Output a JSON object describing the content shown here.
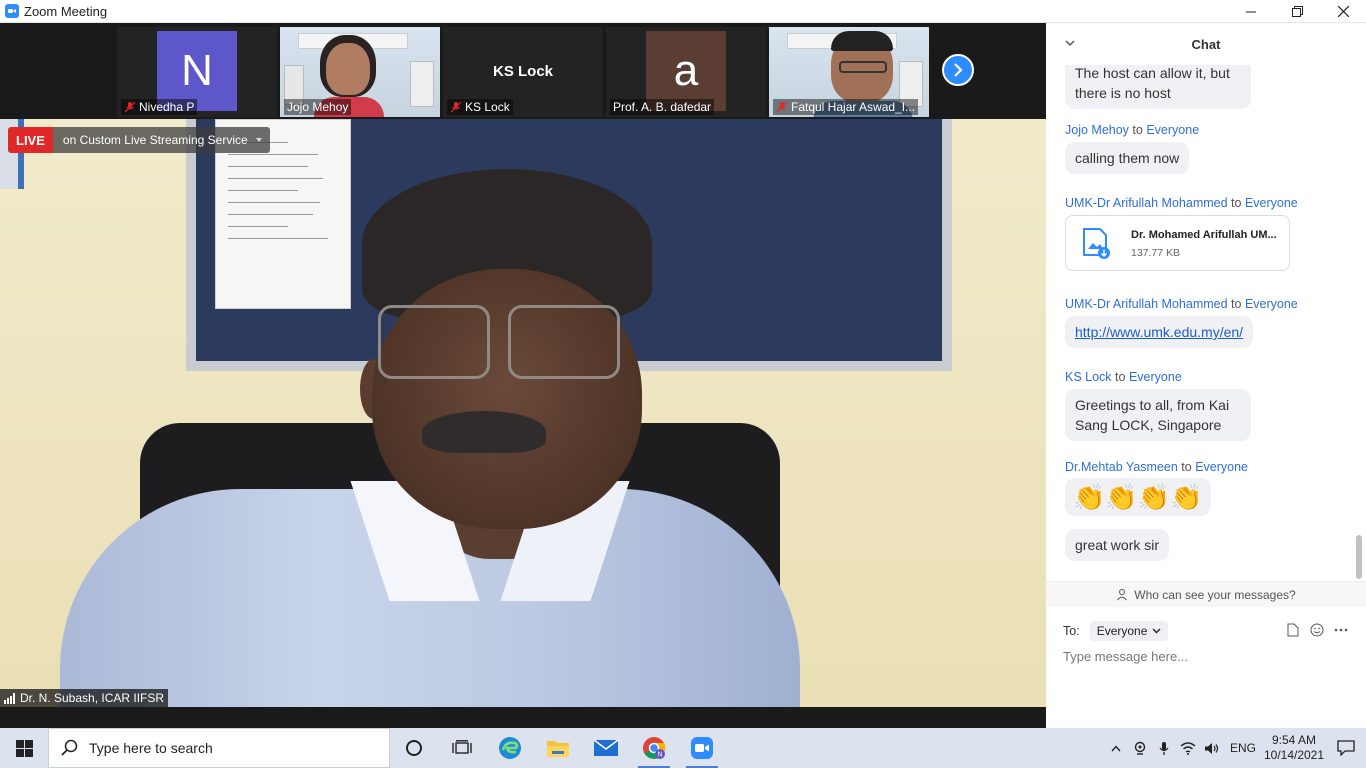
{
  "window": {
    "title": "Zoom Meeting"
  },
  "gallery": {
    "tiles": [
      {
        "name": "Nivedha P",
        "avatar_letter": "N",
        "avatar_color": "#5d57c9",
        "muted": true
      },
      {
        "name": "Jojo Mehoy",
        "muted": false
      },
      {
        "name": "KS Lock",
        "center_name": "KS Lock",
        "muted": true
      },
      {
        "name": "Prof. A. B. dafedar",
        "avatar_letter": "a",
        "avatar_color": "#5a3d33",
        "muted": false
      },
      {
        "name": "Fatqul Hajar Aswad_I...",
        "muted": true
      }
    ]
  },
  "main": {
    "live_label": "LIVE",
    "live_service": "on Custom Live Streaming Service",
    "speaker_name": "Dr. N. Subash, ICAR IIFSR"
  },
  "chat": {
    "title": "Chat",
    "top_partial_text": "The host can allow it, but there is no host",
    "to_word": "to",
    "messages": [
      {
        "sender": "Jojo Mehoy",
        "recipient": "Everyone",
        "text": "calling them now"
      },
      {
        "sender": "UMK-Dr Arifullah Mohammed",
        "recipient": "Everyone",
        "file_name": "Dr. Mohamed Arifullah UM...",
        "file_size": "137.77 KB"
      },
      {
        "sender": "UMK-Dr Arifullah Mohammed",
        "recipient": "Everyone",
        "link": "http://www.umk.edu.my/en/"
      },
      {
        "sender": "KS Lock",
        "recipient": "Everyone",
        "text": "Greetings to all, from Kai Sang LOCK, Singapore"
      },
      {
        "sender": "Dr.Mehtab Yasmeen",
        "recipient": "Everyone",
        "emoji": "👏👏👏👏",
        "text2": "great work sir"
      }
    ],
    "who_can_see": "Who can see your messages?",
    "to_label": "To:",
    "to_value": "Everyone",
    "input_placeholder": "Type message here..."
  },
  "taskbar": {
    "search_placeholder": "Type here to search",
    "language": "ENG",
    "time": "9:54 AM",
    "date": "10/14/2021"
  },
  "colors": {
    "accent": "#2d8cff",
    "live": "#e02828",
    "chat_sender": "#2d6fd6"
  }
}
